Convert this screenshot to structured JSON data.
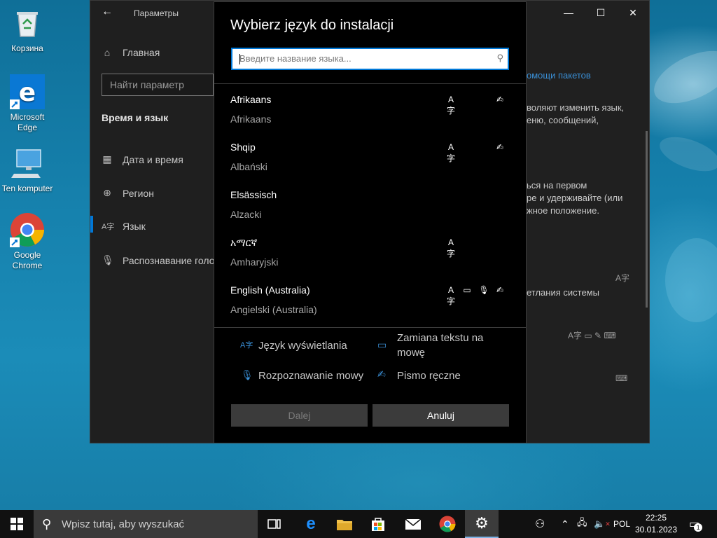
{
  "desktop": {
    "icons": [
      {
        "label": "Корзина",
        "icon": "recycle-bin-icon"
      },
      {
        "label": "Microsoft Edge",
        "icon": "edge-icon"
      },
      {
        "label": "Ten komputer",
        "icon": "computer-icon"
      },
      {
        "label": "Google Chrome",
        "icon": "chrome-icon"
      }
    ]
  },
  "settings": {
    "title": "Параметры",
    "search_placeholder": "Найти параметр",
    "nav": {
      "home": "Главная",
      "category": "Время и язык",
      "items": [
        "Дата и время",
        "Регион",
        "Язык",
        "Распознавание голоса"
      ]
    },
    "right_fragments": [
      "омощи пакетов",
      "воляют изменить язык,",
      "еню, сообщений,",
      "ься на первом",
      "ре и удерживайте (или",
      "жное положение.",
      "етлания системы"
    ]
  },
  "dialog": {
    "title": "Wybierz język do instalacji",
    "search_placeholder": "Введите название языка...",
    "languages": [
      {
        "name": "Afrikaans",
        "sub": "Afrikaans",
        "features": [
          "display",
          "handwriting"
        ]
      },
      {
        "name": "Shqip",
        "sub": "Albański",
        "features": [
          "display",
          "handwriting"
        ]
      },
      {
        "name": "Elsässisch",
        "sub": "Alzacki",
        "features": []
      },
      {
        "name": "አማርኛ",
        "sub": "Amharyjski",
        "features": [
          "display"
        ]
      },
      {
        "name": "English (Australia)",
        "sub": "Angielski (Australia)",
        "features": [
          "display",
          "tts",
          "speech",
          "handwriting"
        ]
      }
    ],
    "legend": {
      "display": "Język wyświetlania",
      "tts": "Zamiana tekstu na mowę",
      "speech": "Rozpoznawanie mowy",
      "handwriting": "Pismo ręczne"
    },
    "buttons": {
      "next": "Dalej",
      "cancel": "Anuluj"
    }
  },
  "taskbar": {
    "search_placeholder": "Wpisz tutaj, aby wyszukać",
    "input_language": "POL",
    "time": "22:25",
    "date": "30.01.2023",
    "notifications": "1"
  },
  "colors": {
    "accent": "#0078d7",
    "dialog_bg": "#000000",
    "settings_bg": "#202020",
    "taskbar_bg": "#111111"
  }
}
